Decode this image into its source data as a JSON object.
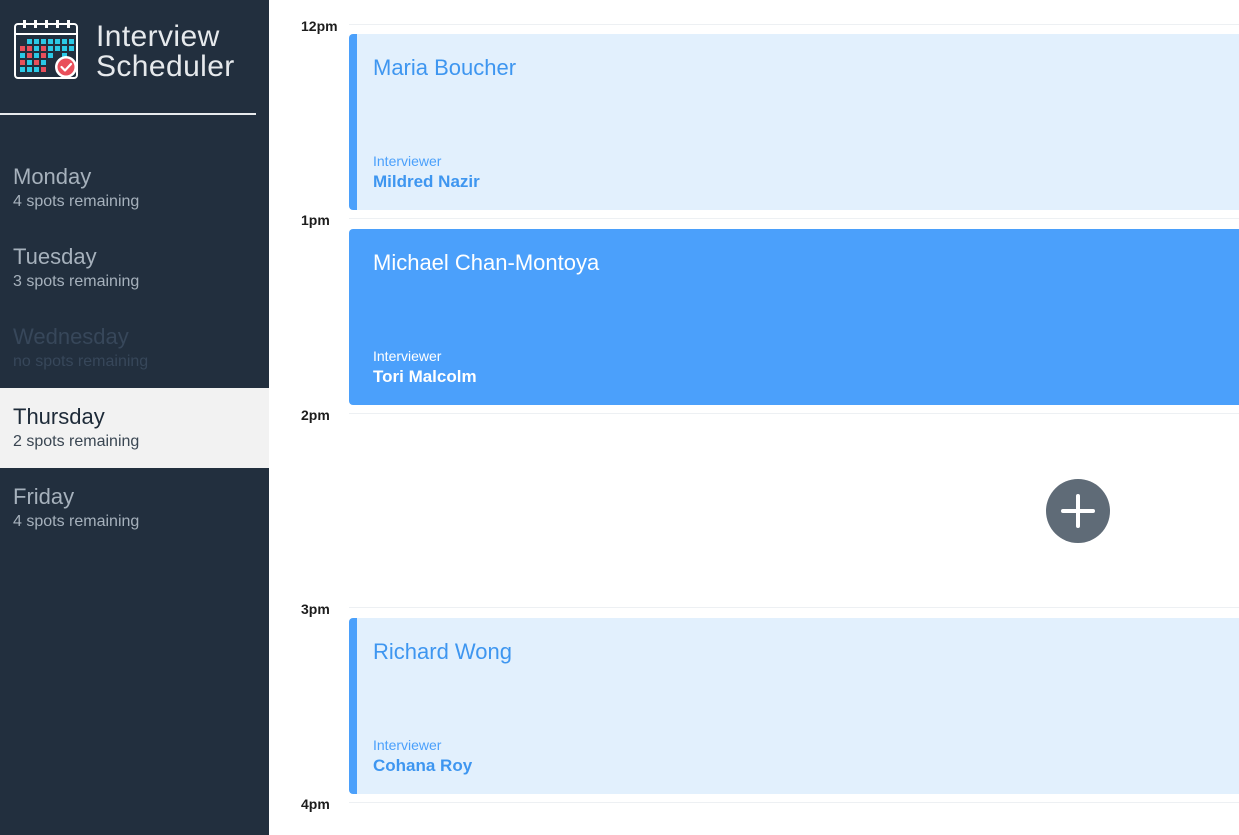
{
  "app": {
    "title_line1": "Interview",
    "title_line2": "Scheduler"
  },
  "sidebar": {
    "days": [
      {
        "name": "Monday",
        "spots": "4 spots remaining",
        "state": "normal"
      },
      {
        "name": "Tuesday",
        "spots": "3 spots remaining",
        "state": "normal"
      },
      {
        "name": "Wednesday",
        "spots": "no spots remaining",
        "state": "full"
      },
      {
        "name": "Thursday",
        "spots": "2 spots remaining",
        "state": "selected"
      },
      {
        "name": "Friday",
        "spots": "4 spots remaining",
        "state": "normal"
      }
    ]
  },
  "schedule": {
    "times": [
      "12pm",
      "1pm",
      "2pm",
      "3pm",
      "4pm"
    ],
    "appointments": [
      {
        "student": "Maria Boucher",
        "interviewer_label": "Interviewer",
        "interviewer": "Mildred Nazir",
        "style": "light"
      },
      {
        "student": "Michael Chan-Montoya",
        "interviewer_label": "Interviewer",
        "interviewer": "Tori Malcolm",
        "style": "dark"
      },
      {
        "student": "Richard Wong",
        "interviewer_label": "Interviewer",
        "interviewer": "Cohana Roy",
        "style": "light"
      }
    ],
    "add_icon": "plus-icon"
  },
  "colors": {
    "sidebar_bg": "#222f3e",
    "accent": "#4ba0fb",
    "accent_light": "#e2f0fd",
    "add_button": "#5f6b77"
  }
}
